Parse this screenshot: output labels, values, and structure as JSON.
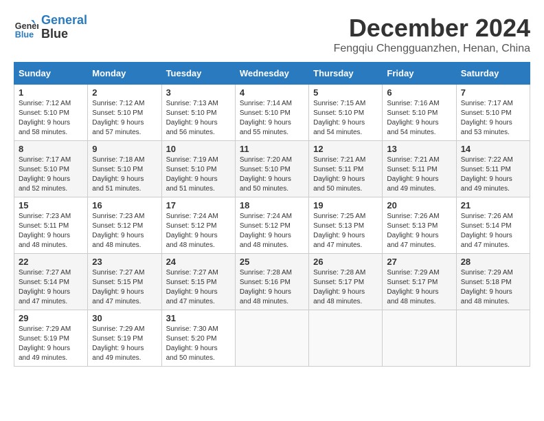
{
  "logo": {
    "line1": "General",
    "line2": "Blue"
  },
  "title": "December 2024",
  "location": "Fengqiu Chengguanzhen, Henan, China",
  "days_of_week": [
    "Sunday",
    "Monday",
    "Tuesday",
    "Wednesday",
    "Thursday",
    "Friday",
    "Saturday"
  ],
  "weeks": [
    [
      {
        "day": 1,
        "sunrise": "7:12 AM",
        "sunset": "5:10 PM",
        "daylight": "9 hours and 58 minutes."
      },
      {
        "day": 2,
        "sunrise": "7:12 AM",
        "sunset": "5:10 PM",
        "daylight": "9 hours and 57 minutes."
      },
      {
        "day": 3,
        "sunrise": "7:13 AM",
        "sunset": "5:10 PM",
        "daylight": "9 hours and 56 minutes."
      },
      {
        "day": 4,
        "sunrise": "7:14 AM",
        "sunset": "5:10 PM",
        "daylight": "9 hours and 55 minutes."
      },
      {
        "day": 5,
        "sunrise": "7:15 AM",
        "sunset": "5:10 PM",
        "daylight": "9 hours and 54 minutes."
      },
      {
        "day": 6,
        "sunrise": "7:16 AM",
        "sunset": "5:10 PM",
        "daylight": "9 hours and 54 minutes."
      },
      {
        "day": 7,
        "sunrise": "7:17 AM",
        "sunset": "5:10 PM",
        "daylight": "9 hours and 53 minutes."
      }
    ],
    [
      {
        "day": 8,
        "sunrise": "7:17 AM",
        "sunset": "5:10 PM",
        "daylight": "9 hours and 52 minutes."
      },
      {
        "day": 9,
        "sunrise": "7:18 AM",
        "sunset": "5:10 PM",
        "daylight": "9 hours and 51 minutes."
      },
      {
        "day": 10,
        "sunrise": "7:19 AM",
        "sunset": "5:10 PM",
        "daylight": "9 hours and 51 minutes."
      },
      {
        "day": 11,
        "sunrise": "7:20 AM",
        "sunset": "5:10 PM",
        "daylight": "9 hours and 50 minutes."
      },
      {
        "day": 12,
        "sunrise": "7:21 AM",
        "sunset": "5:11 PM",
        "daylight": "9 hours and 50 minutes."
      },
      {
        "day": 13,
        "sunrise": "7:21 AM",
        "sunset": "5:11 PM",
        "daylight": "9 hours and 49 minutes."
      },
      {
        "day": 14,
        "sunrise": "7:22 AM",
        "sunset": "5:11 PM",
        "daylight": "9 hours and 49 minutes."
      }
    ],
    [
      {
        "day": 15,
        "sunrise": "7:23 AM",
        "sunset": "5:11 PM",
        "daylight": "9 hours and 48 minutes."
      },
      {
        "day": 16,
        "sunrise": "7:23 AM",
        "sunset": "5:12 PM",
        "daylight": "9 hours and 48 minutes."
      },
      {
        "day": 17,
        "sunrise": "7:24 AM",
        "sunset": "5:12 PM",
        "daylight": "9 hours and 48 minutes."
      },
      {
        "day": 18,
        "sunrise": "7:24 AM",
        "sunset": "5:12 PM",
        "daylight": "9 hours and 48 minutes."
      },
      {
        "day": 19,
        "sunrise": "7:25 AM",
        "sunset": "5:13 PM",
        "daylight": "9 hours and 47 minutes."
      },
      {
        "day": 20,
        "sunrise": "7:26 AM",
        "sunset": "5:13 PM",
        "daylight": "9 hours and 47 minutes."
      },
      {
        "day": 21,
        "sunrise": "7:26 AM",
        "sunset": "5:14 PM",
        "daylight": "9 hours and 47 minutes."
      }
    ],
    [
      {
        "day": 22,
        "sunrise": "7:27 AM",
        "sunset": "5:14 PM",
        "daylight": "9 hours and 47 minutes."
      },
      {
        "day": 23,
        "sunrise": "7:27 AM",
        "sunset": "5:15 PM",
        "daylight": "9 hours and 47 minutes."
      },
      {
        "day": 24,
        "sunrise": "7:27 AM",
        "sunset": "5:15 PM",
        "daylight": "9 hours and 47 minutes."
      },
      {
        "day": 25,
        "sunrise": "7:28 AM",
        "sunset": "5:16 PM",
        "daylight": "9 hours and 48 minutes."
      },
      {
        "day": 26,
        "sunrise": "7:28 AM",
        "sunset": "5:17 PM",
        "daylight": "9 hours and 48 minutes."
      },
      {
        "day": 27,
        "sunrise": "7:29 AM",
        "sunset": "5:17 PM",
        "daylight": "9 hours and 48 minutes."
      },
      {
        "day": 28,
        "sunrise": "7:29 AM",
        "sunset": "5:18 PM",
        "daylight": "9 hours and 48 minutes."
      }
    ],
    [
      {
        "day": 29,
        "sunrise": "7:29 AM",
        "sunset": "5:19 PM",
        "daylight": "9 hours and 49 minutes."
      },
      {
        "day": 30,
        "sunrise": "7:29 AM",
        "sunset": "5:19 PM",
        "daylight": "9 hours and 49 minutes."
      },
      {
        "day": 31,
        "sunrise": "7:30 AM",
        "sunset": "5:20 PM",
        "daylight": "9 hours and 50 minutes."
      },
      null,
      null,
      null,
      null
    ]
  ]
}
